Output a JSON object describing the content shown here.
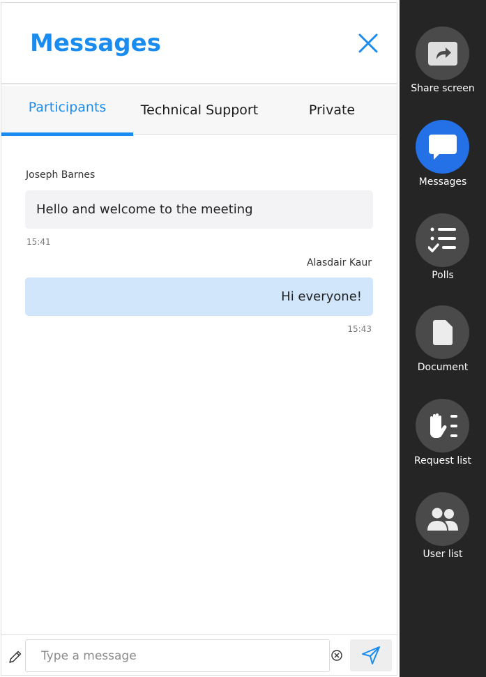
{
  "header": {
    "title": "Messages"
  },
  "tabs": [
    {
      "label": "Participants",
      "active": true
    },
    {
      "label": "Technical Support",
      "active": false
    },
    {
      "label": "Private",
      "active": false
    }
  ],
  "messages": [
    {
      "sender": "Joseph Barnes",
      "text": "Hello and welcome to the meeting",
      "time": "15:41",
      "direction": "incoming"
    },
    {
      "sender": "Alasdair Kaur",
      "text": "Hi everyone!",
      "time": "15:43",
      "direction": "outgoing"
    }
  ],
  "composer": {
    "placeholder": "Type a message",
    "value": ""
  },
  "sidebar": {
    "items": [
      {
        "label": "Share screen",
        "icon": "share-screen-icon",
        "active": false
      },
      {
        "label": "Messages",
        "icon": "chat-bubble-icon",
        "active": true
      },
      {
        "label": "Polls",
        "icon": "checklist-icon",
        "active": false
      },
      {
        "label": "Document",
        "icon": "document-icon",
        "active": false
      },
      {
        "label": "Request list",
        "icon": "raised-hand-icon",
        "active": false
      },
      {
        "label": "User list",
        "icon": "users-icon",
        "active": false
      }
    ]
  },
  "colors": {
    "accent": "#1a8cf0",
    "active_sidebar": "#2470e6",
    "sidebar_bg": "#252525",
    "outgoing_bubble": "#d1e6fb",
    "incoming_bubble": "#f3f3f5"
  }
}
